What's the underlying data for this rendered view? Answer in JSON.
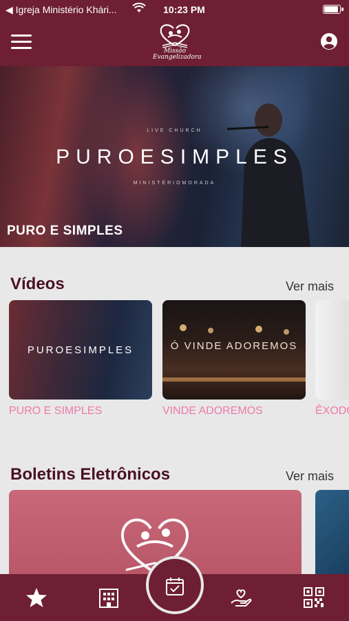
{
  "status_bar": {
    "carrier": "◀ Igreja Ministério Khári...",
    "time": "10:23 PM"
  },
  "header": {
    "logo_text_line1": "Missão",
    "logo_text_line2": "Evangelizadora"
  },
  "hero": {
    "overlay_small_top": "LIVE CHURCH",
    "overlay_title": "PUROESIMPLES",
    "overlay_small_bottom": "MINISTÉRIOMORADA",
    "caption": "PURO E SIMPLES"
  },
  "videos": {
    "title": "Vídeos",
    "see_more": "Ver mais",
    "items": [
      {
        "thumb_title": "PUROESIMPLES",
        "label": "PURO E SIMPLES"
      },
      {
        "thumb_title": "Ó VINDE ADOREMOS",
        "label": "VINDE ADOREMOS"
      },
      {
        "thumb_title": "",
        "label": "ÊXODO"
      }
    ]
  },
  "bulletins": {
    "title": "Boletins Eletrônicos",
    "see_more": "Ver mais"
  },
  "colors": {
    "brand": "#6e1f33",
    "accent_label": "#ee7aa8",
    "section_title": "#4a1022",
    "background": "#e8e8e8"
  },
  "tab_bar": {
    "icons": [
      "star-icon",
      "building-icon",
      "calendar-check-icon",
      "hand-heart-icon",
      "qr-code-icon"
    ]
  }
}
